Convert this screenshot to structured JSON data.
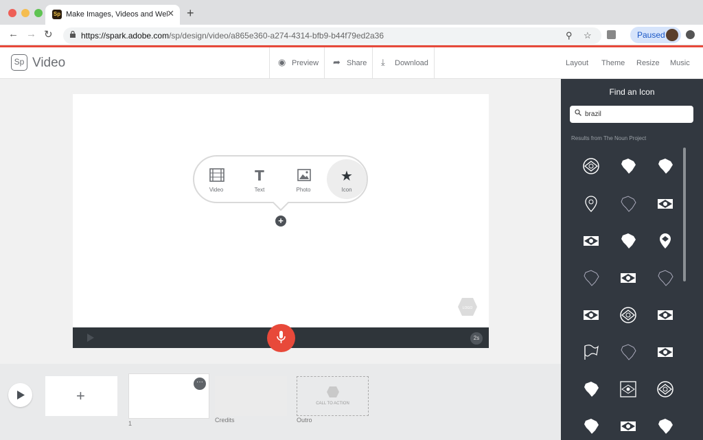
{
  "browser": {
    "tab_title": "Make Images, Videos and Web",
    "tab_favicon": "Sp",
    "url_host": "https://spark.adobe.com",
    "url_path": "/sp/design/video/a865e360-a274-4314-bfb9-b44f79ed2a36",
    "paused_label": "Paused"
  },
  "app": {
    "logo": "Sp",
    "name": "Video",
    "actions": {
      "preview": "Preview",
      "share": "Share",
      "download": "Download"
    },
    "right_links": {
      "layout": "Layout",
      "theme": "Theme",
      "resize": "Resize",
      "music": "Music"
    }
  },
  "picker": {
    "video": "Video",
    "text": "Text",
    "photo": "Photo",
    "icon": "Icon"
  },
  "slide": {
    "logo_placeholder": "LOGO",
    "duration": "2s"
  },
  "timeline": {
    "slide_number": "1",
    "credits": "Credits",
    "outro": "Outro",
    "call_to_action": "CALL TO ACTION"
  },
  "sidebar": {
    "title": "Find an Icon",
    "search_value": "brazil",
    "results_label": "Results from The Noun Project",
    "icons": [
      "brazil-flag-circle-icon",
      "brazil-map-icon",
      "brazil-map-icon",
      "map-pin-icon",
      "brazil-outline-icon",
      "brazil-flag-icon",
      "brazil-flag-icon",
      "brazil-map-icon",
      "brazil-pin-icon",
      "brazil-outline-icon",
      "brazil-flag-icon",
      "brazil-outline-icon",
      "brazil-flag-icon",
      "brazil-flag-circle-icon",
      "brazil-flag-icon",
      "waving-flag-icon",
      "brazil-outline-icon",
      "brazil-flag-icon",
      "brazil-map-icon",
      "brazil-flag-framed-icon",
      "brazil-flag-circle-icon",
      "brazil-map-icon",
      "brazil-flag-icon",
      "brazil-map-icon"
    ]
  },
  "colors": {
    "accent": "#e8493a",
    "panel": "#323840",
    "selected_tab_bg": "#d6e4fb"
  }
}
